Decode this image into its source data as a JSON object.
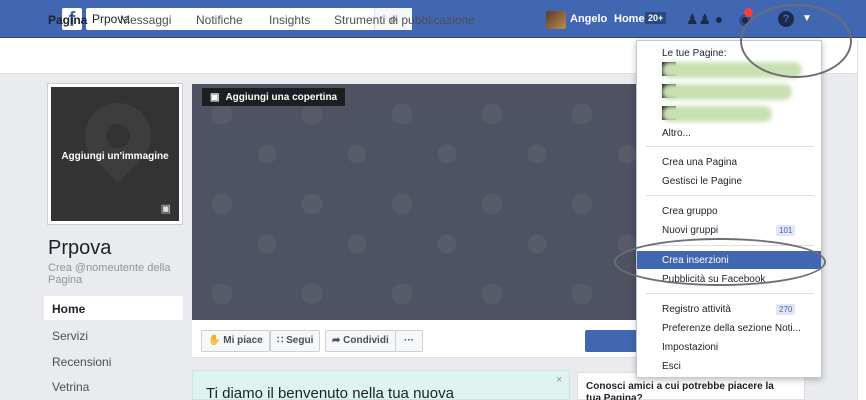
{
  "topbar": {
    "logo": "f",
    "search_value": "Prpova",
    "search_icon": "search-icon",
    "user_name": "Angelo",
    "home_label": "Home",
    "home_badge": "20+",
    "icons": [
      "friends-icon",
      "messages-icon",
      "notifications-icon",
      "help-icon",
      "caret-down-icon"
    ]
  },
  "page_tabs": [
    "Pagina",
    "Messaggi",
    "Notifiche",
    "Insights",
    "Strumenti di pubblicazione"
  ],
  "profile": {
    "add_image_label": "Aggiungi un'immagine",
    "page_name": "Prpova",
    "username_hint": "Crea @nomeutente della Pagina"
  },
  "left_nav": [
    "Home",
    "Servizi",
    "Recensioni",
    "Vetrina"
  ],
  "cover": {
    "add_cover_label": "Aggiungi una copertina"
  },
  "actions": {
    "like": "Mi piace",
    "follow": "Segui",
    "share": "Condividi",
    "more": "···"
  },
  "welcome": {
    "text": "Ti diamo il benvenuto nella tua nuova",
    "close": "×"
  },
  "invite": {
    "text": "Conosci amici a cui potrebbe piacere la tua Pagina?"
  },
  "dropdown": {
    "header": "Le tue Pagine:",
    "altro": "Altro...",
    "crea_pagina": "Crea una Pagina",
    "gestisci_pagine": "Gestisci le Pagine",
    "crea_gruppo": "Crea gruppo",
    "nuovi_gruppi": "Nuovi gruppi",
    "nuovi_gruppi_badge": "101",
    "crea_inserzioni": "Crea inserzioni",
    "pubblicita": "Pubblicità su Facebook",
    "registro": "Registro attività",
    "registro_badge": "270",
    "preferenze": "Preferenze della sezione Noti...",
    "impostazioni": "Impostazioni",
    "esci": "Esci"
  },
  "colors": {
    "brand_blue": "#4267b2",
    "highlight": "#4267b2",
    "cover_bg": "#4e5262"
  }
}
